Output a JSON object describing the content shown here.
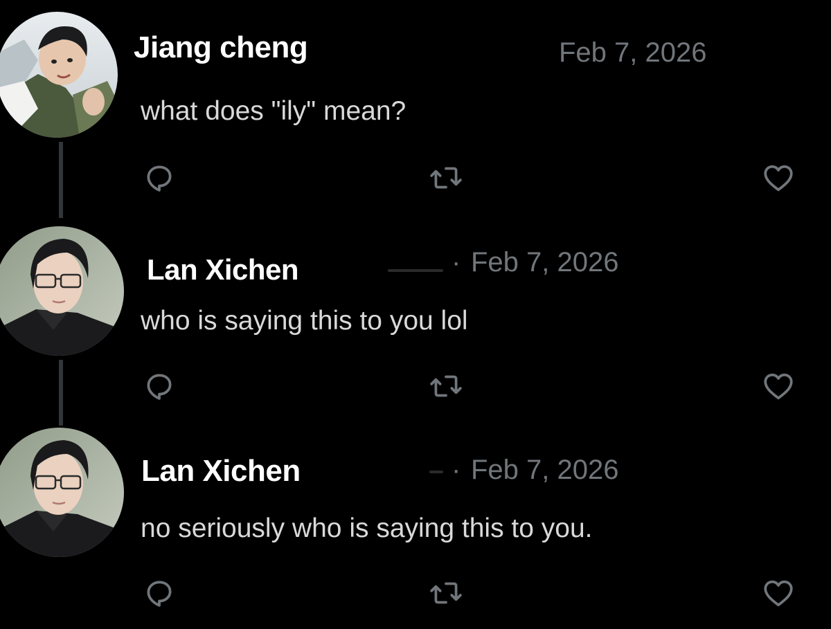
{
  "tweets": [
    {
      "author": "Jiang cheng",
      "date": "Feb 7, 2026",
      "separator": "",
      "text": "what does \"ily\" mean?"
    },
    {
      "author": "Lan Xichen",
      "date": "Feb 7, 2026",
      "separator": "·",
      "text": "who is saying this to you lol"
    },
    {
      "author": "Lan Xichen",
      "date": "Feb 7, 2026",
      "separator": "·",
      "text": "no seriously who is saying this to you."
    }
  ],
  "icons": {
    "reply": "reply-icon",
    "retweet": "retweet-icon",
    "like": "heart-icon"
  },
  "colors": {
    "background": "#000000",
    "name": "#ffffff",
    "date": "#71767b",
    "text": "#d9d9d9",
    "icon": "#71767b",
    "thread_line": "#333639"
  }
}
